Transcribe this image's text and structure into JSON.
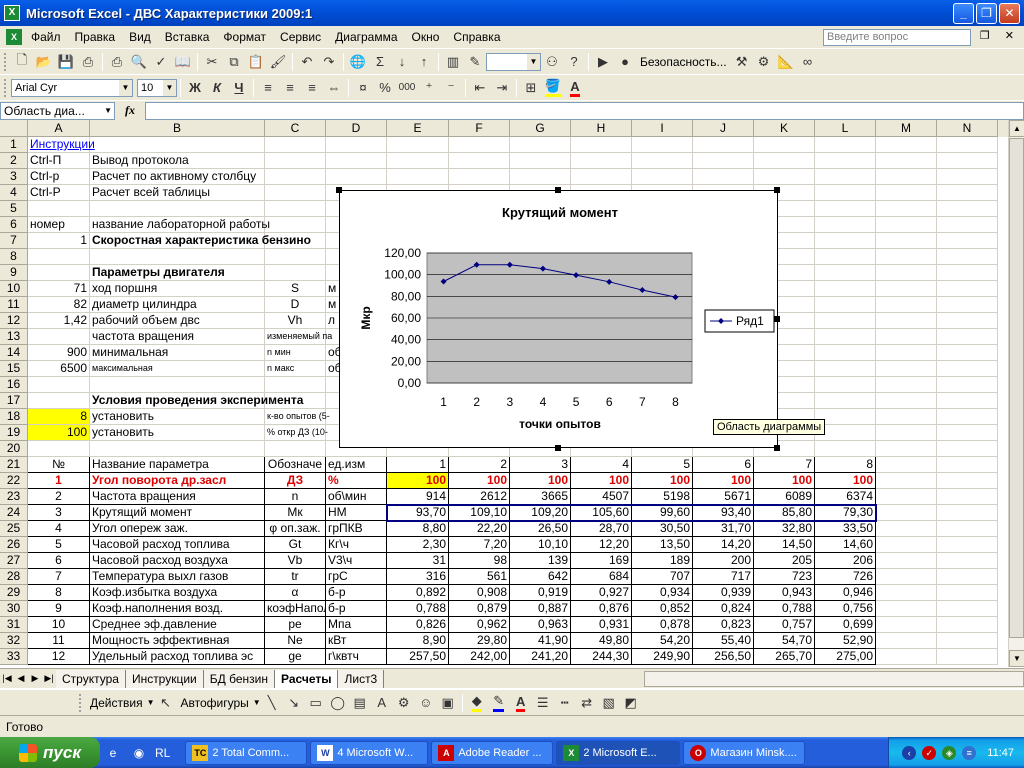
{
  "window": {
    "title": "Microsoft Excel - ДВС Характеристики 2009:1",
    "min": "_",
    "max": "❐",
    "close": "✕"
  },
  "menu": [
    "Файл",
    "Правка",
    "Вид",
    "Вставка",
    "Формат",
    "Сервис",
    "Диаграмма",
    "Окно",
    "Справка"
  ],
  "help_placeholder": "Введите вопрос",
  "toolbar": {
    "security": "Безопасность...",
    "font": "Arial Cyr",
    "size": "10",
    "bold": "Ж",
    "italic": "К",
    "underline": "Ч",
    "percent": "%",
    "comma": "000"
  },
  "formula": {
    "namebox": "Область диа...",
    "fx": "fx",
    "value": ""
  },
  "columns": [
    "A",
    "B",
    "C",
    "D",
    "E",
    "F",
    "G",
    "H",
    "I",
    "J",
    "K",
    "L",
    "M",
    "N"
  ],
  "rows": [
    "1",
    "2",
    "3",
    "4",
    "5",
    "6",
    "7",
    "8",
    "9",
    "10",
    "11",
    "12",
    "13",
    "14",
    "15",
    "16",
    "17",
    "18",
    "19",
    "20",
    "21",
    "22",
    "23",
    "24",
    "25",
    "26",
    "27",
    "28",
    "29",
    "30",
    "31",
    "32",
    "33"
  ],
  "cells": {
    "A1": "Инструкции",
    "A2": "Ctrl-П",
    "B2": "Вывод протокола",
    "A3": "Ctrl-р",
    "B3": "Расчет по активному столбцу",
    "A4": "Ctrl-Р",
    "B4": "Расчет всей таблицы",
    "A6": "номер",
    "B6": "название лабораторной работы",
    "A7": "1",
    "B7": "Скоростная характеристика бензино",
    "B9": "Параметры двигателя",
    "A10": "71",
    "B10": "ход поршня",
    "C10": "S",
    "D10": "м",
    "A11": "82",
    "B11": "диаметр цилиндра",
    "C11": "D",
    "D11": "м",
    "A12": "1,42",
    "B12": "рабочий объем двс",
    "C12": "Vh",
    "D12": "л",
    "B13": "частота вращения",
    "C13": "изменяемый па",
    "A14": "900",
    "B14": "минимальная",
    "C14": "n мин",
    "D14": "об",
    "A15": "6500",
    "B15": "максимальная",
    "C15": "n макс",
    "D15": "об",
    "B17": "Условия проведения эксперимента",
    "A18": "8",
    "B18": "установить",
    "C18": "к-во опытов (5-",
    "A19": "100",
    "B19": "установить",
    "C19": "% откр ДЗ (10-"
  },
  "table": {
    "header": [
      "№",
      "Название параметра",
      "Обозначе",
      "ед.изм",
      "1",
      "2",
      "3",
      "4",
      "5",
      "6",
      "7",
      "8"
    ],
    "rows": [
      [
        "1",
        "Угол поворота др.засл",
        "ДЗ",
        "%",
        "100",
        "100",
        "100",
        "100",
        "100",
        "100",
        "100",
        "100"
      ],
      [
        "2",
        "Частота вращения",
        "n",
        "об\\мин",
        "914",
        "2612",
        "3665",
        "4507",
        "5198",
        "5671",
        "6089",
        "6374"
      ],
      [
        "3",
        "Крутящий момент",
        "Мк",
        "НМ",
        "93,70",
        "109,10",
        "109,20",
        "105,60",
        "99,60",
        "93,40",
        "85,80",
        "79,30"
      ],
      [
        "4",
        "Угол опереж заж.",
        "φ оп.заж.",
        "грПКВ",
        "8,80",
        "22,20",
        "26,50",
        "28,70",
        "30,50",
        "31,70",
        "32,80",
        "33,50"
      ],
      [
        "5",
        "Часовой расход топлива",
        "Gt",
        "Кг\\ч",
        "2,30",
        "7,20",
        "10,10",
        "12,20",
        "13,50",
        "14,20",
        "14,50",
        "14,60"
      ],
      [
        "6",
        "Часовой расход воздуха",
        "Vb",
        "V3\\ч",
        "31",
        "98",
        "139",
        "169",
        "189",
        "200",
        "205",
        "206"
      ],
      [
        "7",
        "Температура выхл газов",
        "tr",
        "грС",
        "316",
        "561",
        "642",
        "684",
        "707",
        "717",
        "723",
        "726"
      ],
      [
        "8",
        "Коэф.избытка воздуха",
        "α",
        "б-р",
        "0,892",
        "0,908",
        "0,919",
        "0,927",
        "0,934",
        "0,939",
        "0,943",
        "0,946"
      ],
      [
        "9",
        "Коэф.наполнения возд.",
        "коэфНапол",
        "б-р",
        "0,788",
        "0,879",
        "0,887",
        "0,876",
        "0,852",
        "0,824",
        "0,788",
        "0,756"
      ],
      [
        "10",
        "Среднее эф.давление",
        "ре",
        "Мпа",
        "0,826",
        "0,962",
        "0,963",
        "0,931",
        "0,878",
        "0,823",
        "0,757",
        "0,699"
      ],
      [
        "11",
        "Мощность эффективная",
        "Ne",
        "кВт",
        "8,90",
        "29,80",
        "41,90",
        "49,80",
        "54,20",
        "55,40",
        "54,70",
        "52,90"
      ],
      [
        "12",
        "Удельный расход топлива эс",
        "ge",
        "г\\квтч",
        "257,50",
        "242,00",
        "241,20",
        "244,30",
        "249,90",
        "256,50",
        "265,70",
        "275,00"
      ]
    ]
  },
  "chart_data": {
    "type": "line",
    "title": "Крутящий момент",
    "xlabel": "точки опытов",
    "ylabel": "Мкр",
    "categories": [
      "1",
      "2",
      "3",
      "4",
      "5",
      "6",
      "7",
      "8"
    ],
    "series": [
      {
        "name": "Ряд1",
        "values": [
          93.7,
          109.1,
          109.2,
          105.6,
          99.6,
          93.4,
          85.8,
          79.3
        ]
      }
    ],
    "ylim": [
      0,
      120
    ],
    "yticks": [
      "0,00",
      "20,00",
      "40,00",
      "60,00",
      "80,00",
      "100,00",
      "120,00"
    ],
    "grid": true,
    "legend": "right",
    "plot_bg": "#c0c0c0",
    "series_color": "#000080"
  },
  "tooltip": "Область диаграммы",
  "sheets": [
    "Структура",
    "Инструкции",
    "БД бензин",
    "Расчеты",
    "Лист3"
  ],
  "active_sheet": "Расчеты",
  "drawing": {
    "actions": "Действия",
    "autoshapes": "Автофигуры"
  },
  "status": "Готово",
  "taskbar": {
    "start": "пуск",
    "lang": "RL",
    "tasks": [
      "2 Total Comm...",
      "4 Microsoft W...",
      "Adobe Reader ...",
      "2 Microsoft E...",
      "Магазин Minsk...."
    ],
    "clock": "11:47"
  }
}
